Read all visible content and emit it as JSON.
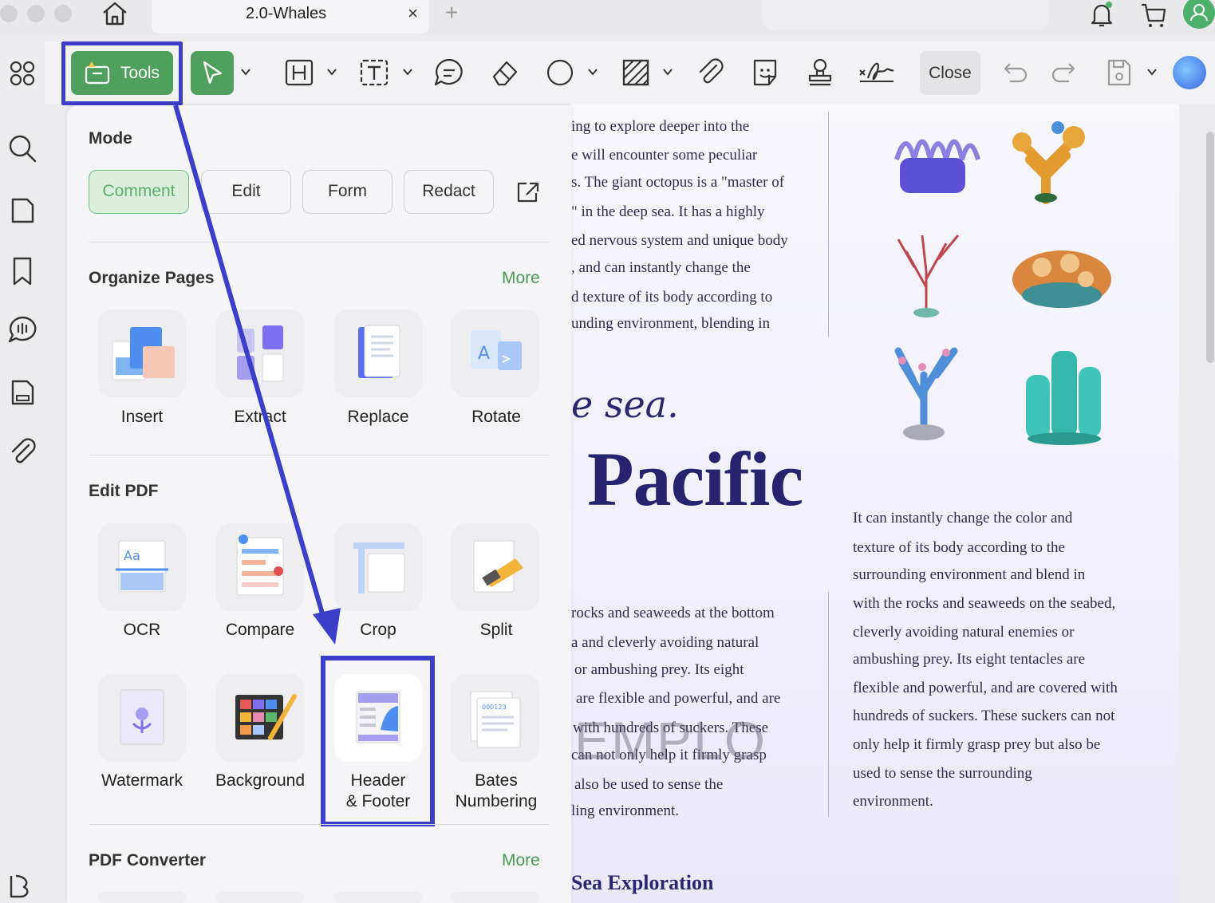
{
  "window": {
    "tab_title": "2.0-Whales",
    "tab_close": "×",
    "tab_add": "+"
  },
  "toolbar": {
    "tools_label": "Tools",
    "close_label": "Close"
  },
  "panel": {
    "mode_title": "Mode",
    "modes": [
      {
        "label": "Comment",
        "active": true
      },
      {
        "label": "Edit",
        "active": false
      },
      {
        "label": "Form",
        "active": false
      },
      {
        "label": "Redact",
        "active": false
      }
    ],
    "organize_title": "Organize Pages",
    "organize_more": "More",
    "organize_items": [
      "Insert",
      "Extract",
      "Replace",
      "Rotate"
    ],
    "edit_title": "Edit PDF",
    "edit_items": [
      "OCR",
      "Compare",
      "Crop",
      "Split",
      "Watermark",
      "Background",
      "Header\n& Footer",
      "Bates\nNumbering"
    ],
    "converter_title": "PDF Converter",
    "converter_more": "More"
  },
  "document": {
    "left_col_top": [
      "ing to explore deeper into the",
      "e will encounter some peculiar",
      "s. The giant octopus is a \"master of",
      "\" in the deep sea. It has a highly",
      "ed nervous system and unique body",
      ", and can instantly change the",
      "d texture of its body according to",
      "unding environment, blending in"
    ],
    "sea_heading": "e sea.",
    "pacific_heading": "Pacific",
    "left_col_bottom": [
      "rocks and seaweeds at the bottom",
      "a and cleverly avoiding natural",
      "or ambushing prey. Its eight",
      "are flexible and powerful, and are",
      "with hundreds of suckers. These",
      "can not only help it firmly grasp",
      "also be used to sense the",
      "ling environment."
    ],
    "right_col": [
      "It can instantly change the color and",
      "texture of its body according to the",
      "surrounding environment and blend in",
      "with the rocks and seaweeds on the seabed,",
      "cleverly avoiding natural enemies or",
      "ambushing prey. Its eight tentacles are",
      "flexible and powerful, and are covered with",
      "hundreds of suckers. These suckers can not",
      "only help it firmly grasp prey but also be",
      "used to sense the surrounding",
      "environment."
    ],
    "watermark": "EMPLO",
    "section_heading": "Sea Exploration"
  },
  "colors": {
    "accent_green": "#4fa05d",
    "highlight_blue": "#3a3ec9",
    "heading_navy": "#26246e"
  }
}
